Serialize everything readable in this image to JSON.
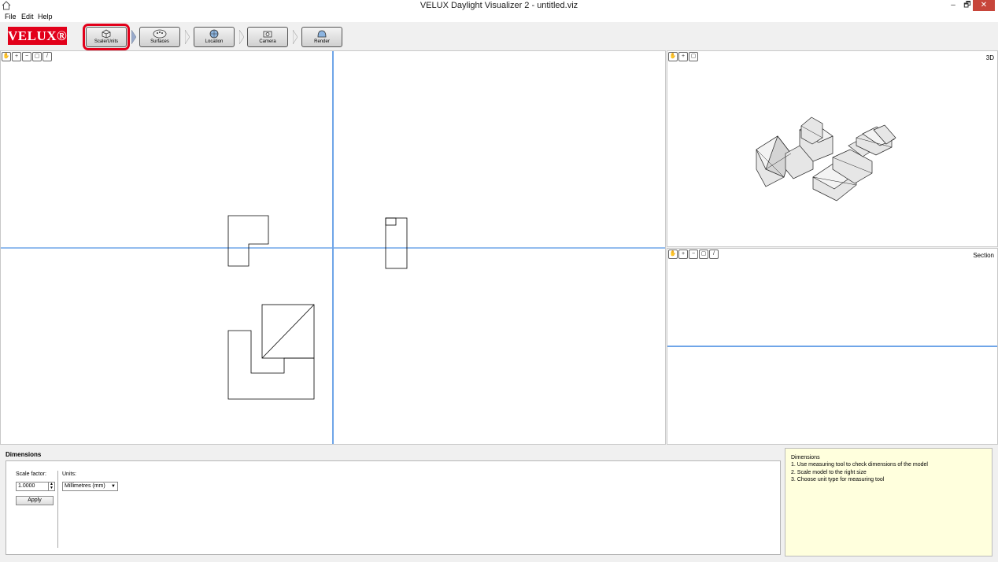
{
  "window": {
    "title": "VELUX Daylight Visualizer 2 - untitled.viz",
    "min_label": "–",
    "max_label": "🗗",
    "close_label": "✕"
  },
  "menu": {
    "items": [
      "File",
      "Edit",
      "Help"
    ]
  },
  "toolbar": {
    "logo": "VELUX®",
    "steps": [
      {
        "label": "Scale/Units",
        "icon": "box-icon",
        "active": true
      },
      {
        "label": "Surfaces",
        "icon": "palette-icon",
        "active": false
      },
      {
        "label": "Location",
        "icon": "globe-icon",
        "active": false
      },
      {
        "label": "Camera",
        "icon": "camera-icon",
        "active": false
      },
      {
        "label": "Render",
        "icon": "render-icon",
        "active": false
      }
    ]
  },
  "viewports": {
    "main": {
      "tools": [
        "pan-icon",
        "zoom-in-icon",
        "zoom-out-icon",
        "zoom-fit-icon",
        "measure-icon"
      ]
    },
    "three_d": {
      "label": "3D",
      "tools": [
        "pan-icon",
        "zoom-in-icon",
        "zoom-fit-icon"
      ]
    },
    "section": {
      "label": "Section",
      "tools": [
        "pan-icon",
        "zoom-in-icon",
        "zoom-out-icon",
        "zoom-fit-icon",
        "measure-icon"
      ]
    }
  },
  "dimensions_panel": {
    "title": "Dimensions",
    "scale_label": "Scale factor:",
    "scale_value": "1.0000",
    "apply_label": "Apply",
    "units_label": "Units:",
    "units_value": "Millimetres (mm)"
  },
  "help": {
    "title": "Dimensions",
    "lines": [
      "1. Use measuring tool to check dimensions of the model",
      "2. Scale model to the right size",
      "3. Choose unit type for measuring tool"
    ]
  },
  "colors": {
    "accent": "#e2001a",
    "guide_line": "#6fa5e8",
    "help_bg": "#ffffdd"
  }
}
